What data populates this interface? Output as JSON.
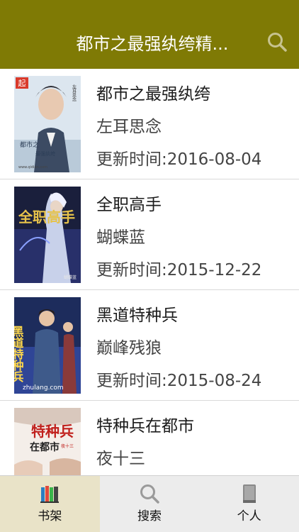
{
  "navbar": {
    "title": "都市之最强纨绔精...",
    "search_icon": "search-icon"
  },
  "books": [
    {
      "title": "都市之最强纨绔",
      "author": "左耳思念",
      "updated": "更新时间:2016-08-04"
    },
    {
      "title": "全职高手",
      "author": "蝴蝶蓝",
      "updated": "更新时间:2015-12-22"
    },
    {
      "title": "黑道特种兵",
      "author": "巅峰残狼",
      "updated": "更新时间:2015-08-24"
    },
    {
      "title": "特种兵在都市",
      "author": "夜十三",
      "updated": ""
    }
  ],
  "covers": {
    "book0": {
      "logo": "起",
      "text1": "左耳思念",
      "text2": "都市之",
      "text3": "最强纨绔",
      "url": "www.qidian.com"
    },
    "book1": {
      "art": "全职高手",
      "text1": "蝴蝶蓝"
    },
    "book2": {
      "art": "黑道特种兵",
      "url": "zhulang.com"
    },
    "book3": {
      "art": "特种兵",
      "art2": "在都市",
      "sub": "夜十三"
    }
  },
  "tabbar": {
    "tabs": [
      {
        "label": "书架",
        "icon": "bookshelf-icon"
      },
      {
        "label": "搜索",
        "icon": "search-icon"
      },
      {
        "label": "个人",
        "icon": "book-icon"
      }
    ]
  },
  "colors": {
    "navbar": "#7f7a05",
    "active_tab": "#e9e3c8"
  }
}
